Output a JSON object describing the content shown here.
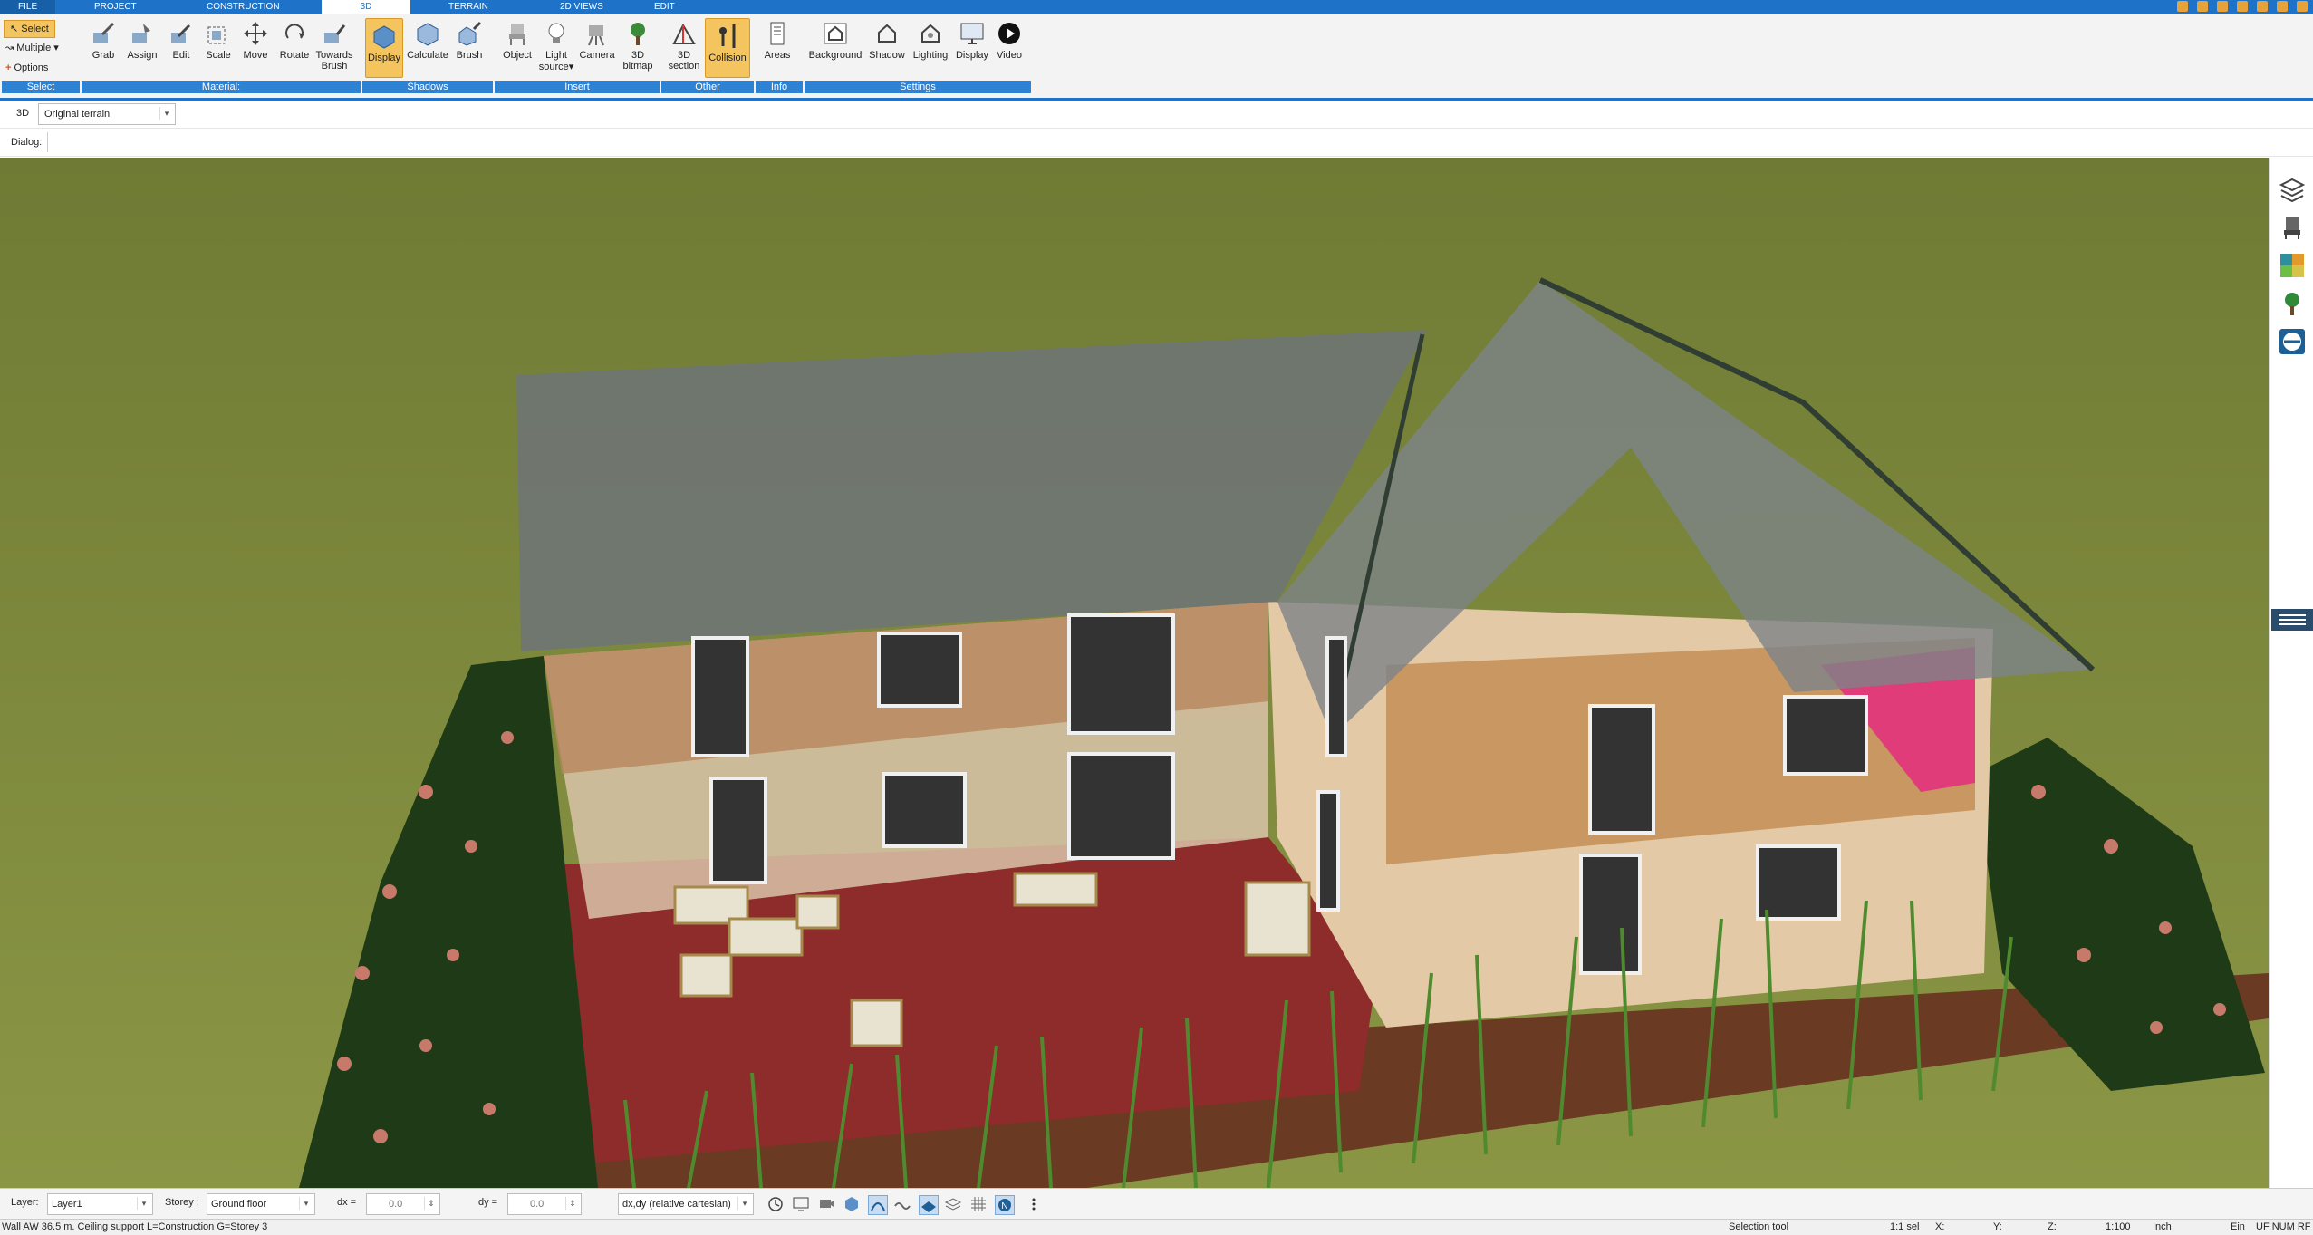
{
  "tabs": [
    "FILE",
    "PROJECT",
    "CONSTRUCTION",
    "3D",
    "TERRAIN",
    "2D VIEWS",
    "EDIT"
  ],
  "ribbon": {
    "select_group": {
      "select": "Select",
      "multiple": "Multiple",
      "options": "Options"
    },
    "material": {
      "grab": "Grab",
      "assign": "Assign",
      "edit": "Edit",
      "scale": "Scale",
      "move": "Move",
      "rotate": "Rotate",
      "towards_brush_1": "Towards",
      "towards_brush_2": "Brush"
    },
    "shadows": {
      "display": "Display",
      "calculate": "Calculate",
      "brush": "Brush"
    },
    "insert": {
      "object": "Object",
      "light_source_1": "Light",
      "light_source_2": "source",
      "camera": "Camera",
      "bitmap_1": "3D",
      "bitmap_2": "bitmap"
    },
    "other": {
      "section_1": "3D",
      "section_2": "section",
      "collision": "Collision"
    },
    "info": {
      "areas": "Areas"
    },
    "settings": {
      "background": "Background",
      "shadow": "Shadow",
      "lighting": "Lighting",
      "display": "Display",
      "video": "Video"
    },
    "groups": {
      "select": "Select",
      "material": "Material:",
      "shadows": "Shadows",
      "insert": "Insert",
      "other": "Other",
      "info": "Info",
      "settings": "Settings"
    }
  },
  "view_row": {
    "mode": "3D",
    "terrain_select": "Original terrain"
  },
  "dialog_row": {
    "label": "Dialog:"
  },
  "bottombar": {
    "layer_label": "Layer:",
    "layer_value": "Layer1",
    "storey_label": "Storey :",
    "storey_value": "Ground floor",
    "dx_label": "dx =",
    "dx_value": "0.0",
    "dy_label": "dy =",
    "dy_value": "0.0",
    "coord_mode": "dx,dy (relative cartesian)"
  },
  "statusbar": {
    "message": "Wall AW 36.5 m. Ceiling support L=Construction G=Storey 3",
    "tool": "Selection tool",
    "sel": "1:1 sel",
    "x": "X:",
    "y": "Y:",
    "z": "Z:",
    "scale": "1:100",
    "unit": "Inch",
    "ein": "Ein",
    "flags": "UF NUM RF"
  },
  "colors": {
    "accent": "#1e73c8",
    "active_btn": "#f4c45f",
    "lawn": "#7e8a3c",
    "patio": "#8e2b2b"
  }
}
